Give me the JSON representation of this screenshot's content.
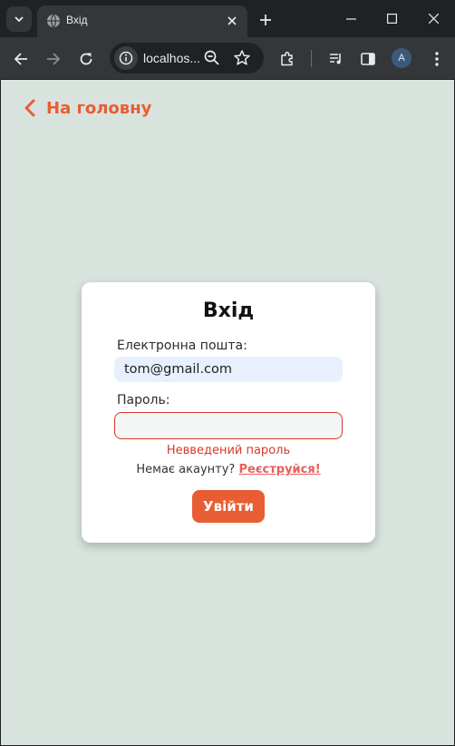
{
  "browser": {
    "tab": {
      "title": "Вхід"
    },
    "omnibox": {
      "url": "localhos..."
    },
    "profile": {
      "initial": "A"
    }
  },
  "page": {
    "back_link": "На головну",
    "form": {
      "title": "Вхід",
      "email_label": "Електронна пошта:",
      "email_value": "tom@gmail.com",
      "password_label": "Пароль:",
      "password_value": "",
      "password_error": "Невведений пароль",
      "no_account_text": "Немає акаунту?",
      "register_link": "Реєструйся!",
      "submit_label": "Увійти"
    }
  },
  "colors": {
    "accent": "#e85d33",
    "error": "#d33a2a",
    "page_background": "#d8e3dd",
    "autofill_background": "#e8f0fe"
  },
  "icons": [
    "tab-search-icon",
    "globe-icon",
    "close-icon",
    "plus-icon",
    "minimize-icon",
    "maximize-icon",
    "window-close-icon",
    "back-arrow-icon",
    "forward-arrow-icon",
    "reload-icon",
    "info-icon",
    "zoom-icon",
    "star-icon",
    "extensions-icon",
    "media-icon",
    "side-panel-icon",
    "more-icon",
    "chevron-left-icon"
  ]
}
